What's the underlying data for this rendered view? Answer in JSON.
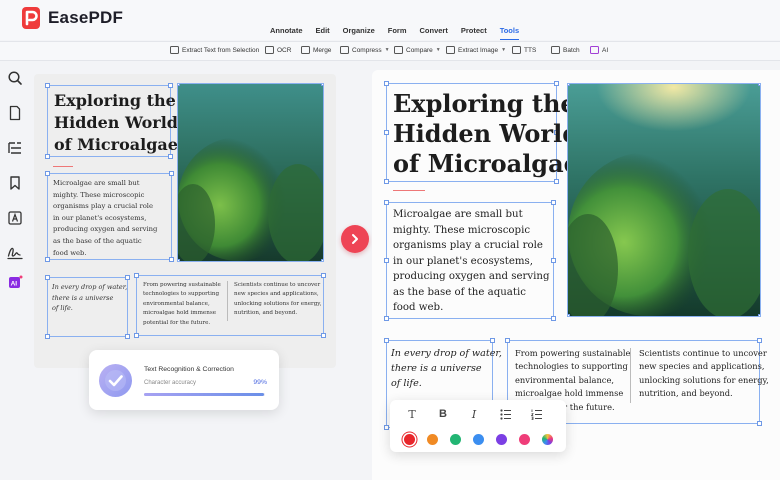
{
  "app": {
    "name": "EasePDF"
  },
  "menu": [
    {
      "label": "Annotate"
    },
    {
      "label": "Edit"
    },
    {
      "label": "Organize"
    },
    {
      "label": "Form"
    },
    {
      "label": "Convert"
    },
    {
      "label": "Protect"
    },
    {
      "label": "Tools",
      "active": true
    }
  ],
  "toolbar": [
    {
      "label": "Extract Text from Selection",
      "icon": "scan-text-icon"
    },
    {
      "label": "OCR",
      "icon": "ocr-icon"
    },
    {
      "label": "Merge",
      "icon": "merge-icon"
    },
    {
      "label": "Compress",
      "icon": "compress-icon",
      "dropdown": true
    },
    {
      "label": "Compare",
      "icon": "compare-icon",
      "dropdown": true
    },
    {
      "label": "Extract Image",
      "icon": "extract-image-icon",
      "dropdown": true
    },
    {
      "label": "TTS",
      "icon": "tts-icon"
    },
    {
      "label": "Batch",
      "icon": "batch-icon"
    },
    {
      "label": "AI",
      "icon": "ai-icon"
    }
  ],
  "sidebar": [
    "search-icon",
    "page-icon",
    "outline-icon",
    "bookmark-icon",
    "text-field-icon",
    "signature-icon",
    "ai-assistant-icon"
  ],
  "document": {
    "title_line1": "Exploring the",
    "title_line2": "Hidden World",
    "title_line3": "of Microalgae",
    "intro": [
      "Microalgae are small but",
      "mighty. These microscopic",
      "organisms play a crucial role",
      "in our planet's ecosystems,",
      "producing oxygen and serving",
      "as the base of the aquatic",
      "food web."
    ],
    "quote": [
      "In every drop of water,",
      "there is a universe",
      "of life."
    ],
    "col1": [
      "From powering sustainable",
      "technologies to supporting",
      "environmental balance,",
      "microalgae hold immense",
      "potential for the future."
    ],
    "col2": [
      "Scientists continue to uncover",
      "new species and applications,",
      "unlocking solutions for energy,",
      "nutrition, and beyond."
    ]
  },
  "ocr_card": {
    "title": "Text Recognition & Correction",
    "label": "Character accuracy",
    "value_text": "99%",
    "accuracy": 0.99
  },
  "format_bar": {
    "buttons": [
      {
        "name": "text-icon",
        "glyph": "T"
      },
      {
        "name": "bold-icon",
        "glyph": "B"
      },
      {
        "name": "italic-icon",
        "glyph": "I"
      },
      {
        "name": "bullet-list-icon",
        "glyph": "≔"
      },
      {
        "name": "numbered-list-icon",
        "glyph": "≔"
      }
    ],
    "colors": [
      "#e8262b",
      "#f08a24",
      "#22b573",
      "#3b8ef0",
      "#7b3fe4",
      "#ef3d79",
      "rainbow"
    ],
    "selected_color": "#e8262b"
  }
}
